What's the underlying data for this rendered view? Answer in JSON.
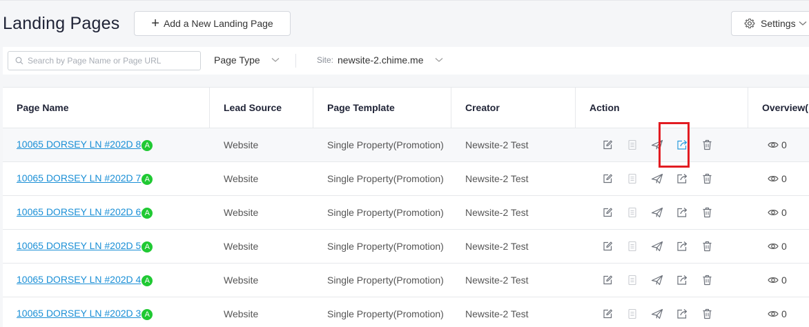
{
  "header": {
    "title": "Landing Pages",
    "add_label": "Add a New Landing Page",
    "settings_label": "Settings"
  },
  "filters": {
    "search_placeholder": "Search by Page Name or Page URL",
    "page_type_label": "Page Type",
    "site_label": "Site:",
    "site_value": "newsite-2.chime.me"
  },
  "table": {
    "columns": [
      "Page Name",
      "Lead Source",
      "Page Template",
      "Creator",
      "Action",
      "Overview("
    ],
    "rows": [
      {
        "name": "10065 DORSEY LN #202D 8",
        "badge": "A",
        "source": "Website",
        "template": "Single Property(Promotion)",
        "creator": "Newsite-2 Test",
        "views": "0"
      },
      {
        "name": "10065 DORSEY LN #202D 7",
        "badge": "A",
        "source": "Website",
        "template": "Single Property(Promotion)",
        "creator": "Newsite-2 Test",
        "views": "0"
      },
      {
        "name": "10065 DORSEY LN #202D 6",
        "badge": "A",
        "source": "Website",
        "template": "Single Property(Promotion)",
        "creator": "Newsite-2 Test",
        "views": "0"
      },
      {
        "name": "10065 DORSEY LN #202D 5",
        "badge": "A",
        "source": "Website",
        "template": "Single Property(Promotion)",
        "creator": "Newsite-2 Test",
        "views": "0"
      },
      {
        "name": "10065 DORSEY LN #202D 4",
        "badge": "A",
        "source": "Website",
        "template": "Single Property(Promotion)",
        "creator": "Newsite-2 Test",
        "views": "0"
      },
      {
        "name": "10065 DORSEY LN #202D 3",
        "badge": "A",
        "source": "Website",
        "template": "Single Property(Promotion)",
        "creator": "Newsite-2 Test",
        "views": "0"
      }
    ]
  },
  "icons": {
    "action_icons": [
      "edit-icon",
      "copy-icon",
      "send-icon",
      "share-icon",
      "delete-icon"
    ],
    "overview_icon": "eye-icon"
  },
  "colors": {
    "link": "#1a8fd6",
    "badge": "#20c933",
    "highlight": "#e21c22",
    "active_icon": "#2a9bdc"
  }
}
